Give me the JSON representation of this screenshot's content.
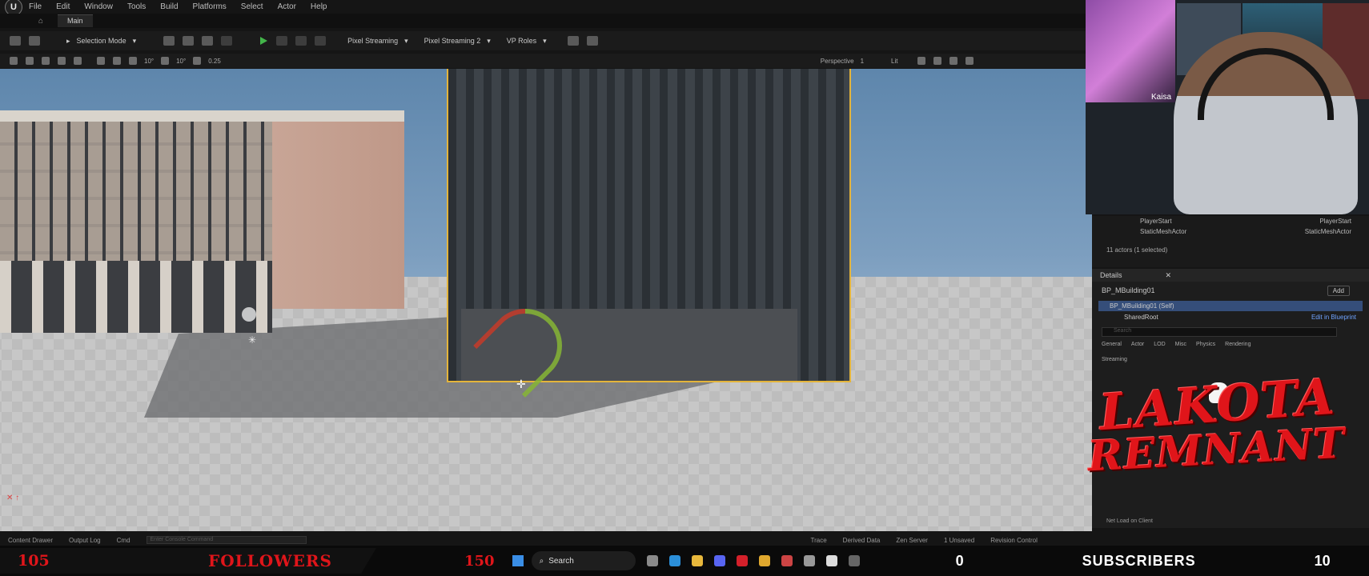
{
  "menubar": {
    "logo": "U",
    "items": [
      "File",
      "Edit",
      "Window",
      "Tools",
      "Build",
      "Platforms",
      "Select",
      "Actor",
      "Help"
    ]
  },
  "tabbar": {
    "tab_label": "Main"
  },
  "toolbar": {
    "selection_mode": "Selection Mode",
    "pixel_streaming": "Pixel Streaming",
    "pixel_streaming_2": "Pixel Streaming 2",
    "vp_roles": "VP Roles"
  },
  "viewport_toolbar": {
    "grid_snap": "10°",
    "angle_snap": "10°",
    "scale_snap": "0.25",
    "perspective": "Perspective",
    "lit": "Lit",
    "view_count": "1"
  },
  "webcam": {
    "overlay_name": "Kaisa"
  },
  "outliner": {
    "rows": [
      {
        "label": "PlayerStart",
        "type": "PlayerStart"
      },
      {
        "label": "StaticMeshActor",
        "type": "StaticMeshActor"
      }
    ],
    "count_text": "11 actors (1 selected)"
  },
  "details": {
    "title": "Details",
    "actor_name": "BP_MBuilding01",
    "add_label": "Add",
    "self_label": "BP_MBuilding01 (Self)",
    "shared_root": "SharedRoot",
    "edit_in_blueprint": "Edit in Blueprint",
    "search_placeholder": "Search",
    "filters": [
      "General",
      "Actor",
      "LOD",
      "Misc",
      "Physics",
      "Rendering",
      "Streaming"
    ],
    "net_load": "Net Load on Client"
  },
  "logo": {
    "line1": "LAKOTA",
    "line2": "REMNANT"
  },
  "bottombar": {
    "content_drawer": "Content Drawer",
    "output_log": "Output Log",
    "cmd": "Cmd",
    "console_placeholder": "Enter Console Command",
    "trace": "Trace",
    "derived_data": "Derived Data",
    "zen_server": "Zen Server",
    "unsaved": "1 Unsaved",
    "revision_control": "Revision Control"
  },
  "stream_bar": {
    "followers_count": "105",
    "followers_label": "FOLLOWERS",
    "followers_goal": "150",
    "search_label": "Search",
    "subscribers_count": "0",
    "subscribers_label": "SUBSCRIBERS",
    "subscribers_goal": "10"
  },
  "colors": {
    "accent_red": "#e0151a",
    "selection_outline": "#e4b43a",
    "selected_row": "#354e7a",
    "play_green": "#43b54a"
  }
}
